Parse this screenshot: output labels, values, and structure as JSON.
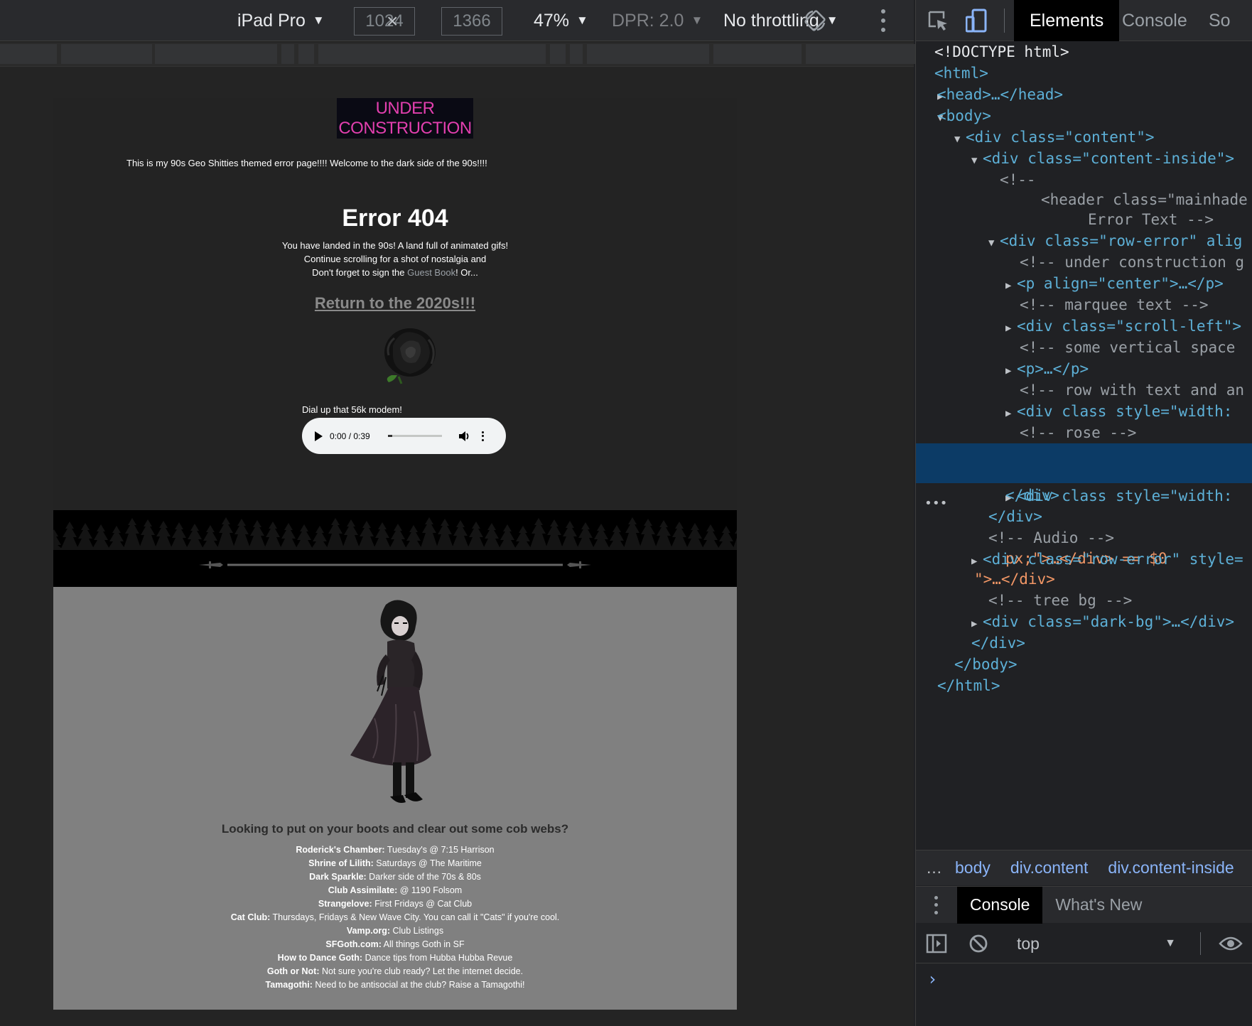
{
  "device_toolbar": {
    "device": "iPad Pro",
    "width": "1024",
    "height": "1366",
    "x_sep": "×",
    "zoom": "47%",
    "dpr": "DPR: 2.0",
    "throttling": "No throttling"
  },
  "page": {
    "banner_line1": "UNDER",
    "banner_line2": "CONSTRUCTION",
    "marquee": "This is my 90s Geo Shitties themed error page!!!! Welcome to the dark side of the 90s!!!!",
    "title": "Error 404",
    "intro_line1": "You have landed in the 90s! A land full of animated gifs!",
    "intro_line2": "Continue scrolling for a shot of nostalgia and",
    "intro_line3_a": "Don't forget to sign the ",
    "guest_book": "Guest Book",
    "intro_line3_b": "! Or...",
    "return_link": "Return to the 2020s!!!",
    "audio_label": "Dial up that 56k modem!",
    "audio_time": "0:00 / 0:39",
    "audio_progress": 0.0,
    "clubs_heading": "Looking to put on your boots and clear out some cob webs?",
    "clubs": [
      {
        "name": "Roderick's Chamber:",
        "desc": " Tuesday's @ 7:15 Harrison"
      },
      {
        "name": "Shrine of Lilith:",
        "desc": " Saturdays @ The Maritime"
      },
      {
        "name": "Dark Sparkle:",
        "desc": " Darker side of the 70s & 80s"
      },
      {
        "name": "Club Assimilate:",
        "desc": " @ 1190 Folsom"
      },
      {
        "name": "Strangelove:",
        "desc": " First Fridays @ Cat Club"
      },
      {
        "name": "Cat Club:",
        "desc": " Thursdays, Fridays & New Wave City. You can call it \"Cats\" if you're cool."
      },
      {
        "name": "Vamp.org:",
        "desc": " Club Listings"
      },
      {
        "name": "SFGoth.com:",
        "desc": " All things Goth in SF"
      },
      {
        "name": "How to Dance Goth:",
        "desc": " Dance tips from Hubba Hubba Revue"
      },
      {
        "name": "Goth or Not:",
        "desc": " Not sure you're club ready? Let the internet decide."
      },
      {
        "name": "Tamagothi:",
        "desc": " Need to be antisocial at the club? Raise a Tamagothi!"
      }
    ]
  },
  "devtools": {
    "tabs": [
      "Elements",
      "Console",
      "So"
    ],
    "active_tab": "Elements",
    "dom": [
      {
        "t": "<!DOCTYPE html>"
      },
      {
        "t": "<html>"
      },
      {
        "t": "<head>…</head>"
      },
      {
        "t": "<body>"
      },
      {
        "t": "<div class=\"content\">"
      },
      {
        "t": "<div class=\"content-inside\">"
      },
      {
        "t": "<!--"
      },
      {
        "t": "<header class=\"mainhade"
      },
      {
        "t": "Error Text -->"
      },
      {
        "t": "<div class=\"row-error\" alig"
      },
      {
        "t": "<!-- under construction g"
      },
      {
        "t": "<p align=\"center\">…</p>"
      },
      {
        "t": "<!-- marquee text -->"
      },
      {
        "t": "<div class=\"scroll-left\">"
      },
      {
        "t": "<!-- some vertical space"
      },
      {
        "t": "<p>…</p>"
      },
      {
        "t": "<!-- row with text and an"
      },
      {
        "t": "<div class style=\"width:"
      },
      {
        "t": "<!-- rose -->"
      },
      {
        "t": "<div class style=\"width:"
      },
      {
        "t": "px;\">…</div> == $0"
      },
      {
        "t": "</div>"
      },
      {
        "t": "</div>"
      },
      {
        "t": "<!-- Audio -->"
      },
      {
        "t": "<div class=\"row-error\" style="
      },
      {
        "t": "\">…</div>"
      },
      {
        "t": "<!-- tree bg -->"
      },
      {
        "t": "<div class=\"dark-bg\">…</div>"
      },
      {
        "t": "</div>"
      },
      {
        "t": "</body>"
      },
      {
        "t": "</html>"
      }
    ],
    "breadcrumbs": [
      "body",
      "div.content",
      "div.content-inside"
    ],
    "breadcrumb_more": "…",
    "drawer_tabs": [
      "Console",
      "What's New"
    ],
    "context": "top",
    "prompt": "›"
  },
  "icons": {
    "rotate": "rotate-device-icon",
    "inspect": "inspect-element-icon",
    "device": "device-toggle-icon",
    "eye": "eye-icon",
    "clear": "clear-console-icon",
    "sidebar": "console-sidebar-icon"
  },
  "colors": {
    "banner_text": "#e23fae",
    "selected_row": "#0c3b66",
    "link": "#8ab4f8",
    "tag": "#5db0d7",
    "attr_value": "#f29766"
  }
}
